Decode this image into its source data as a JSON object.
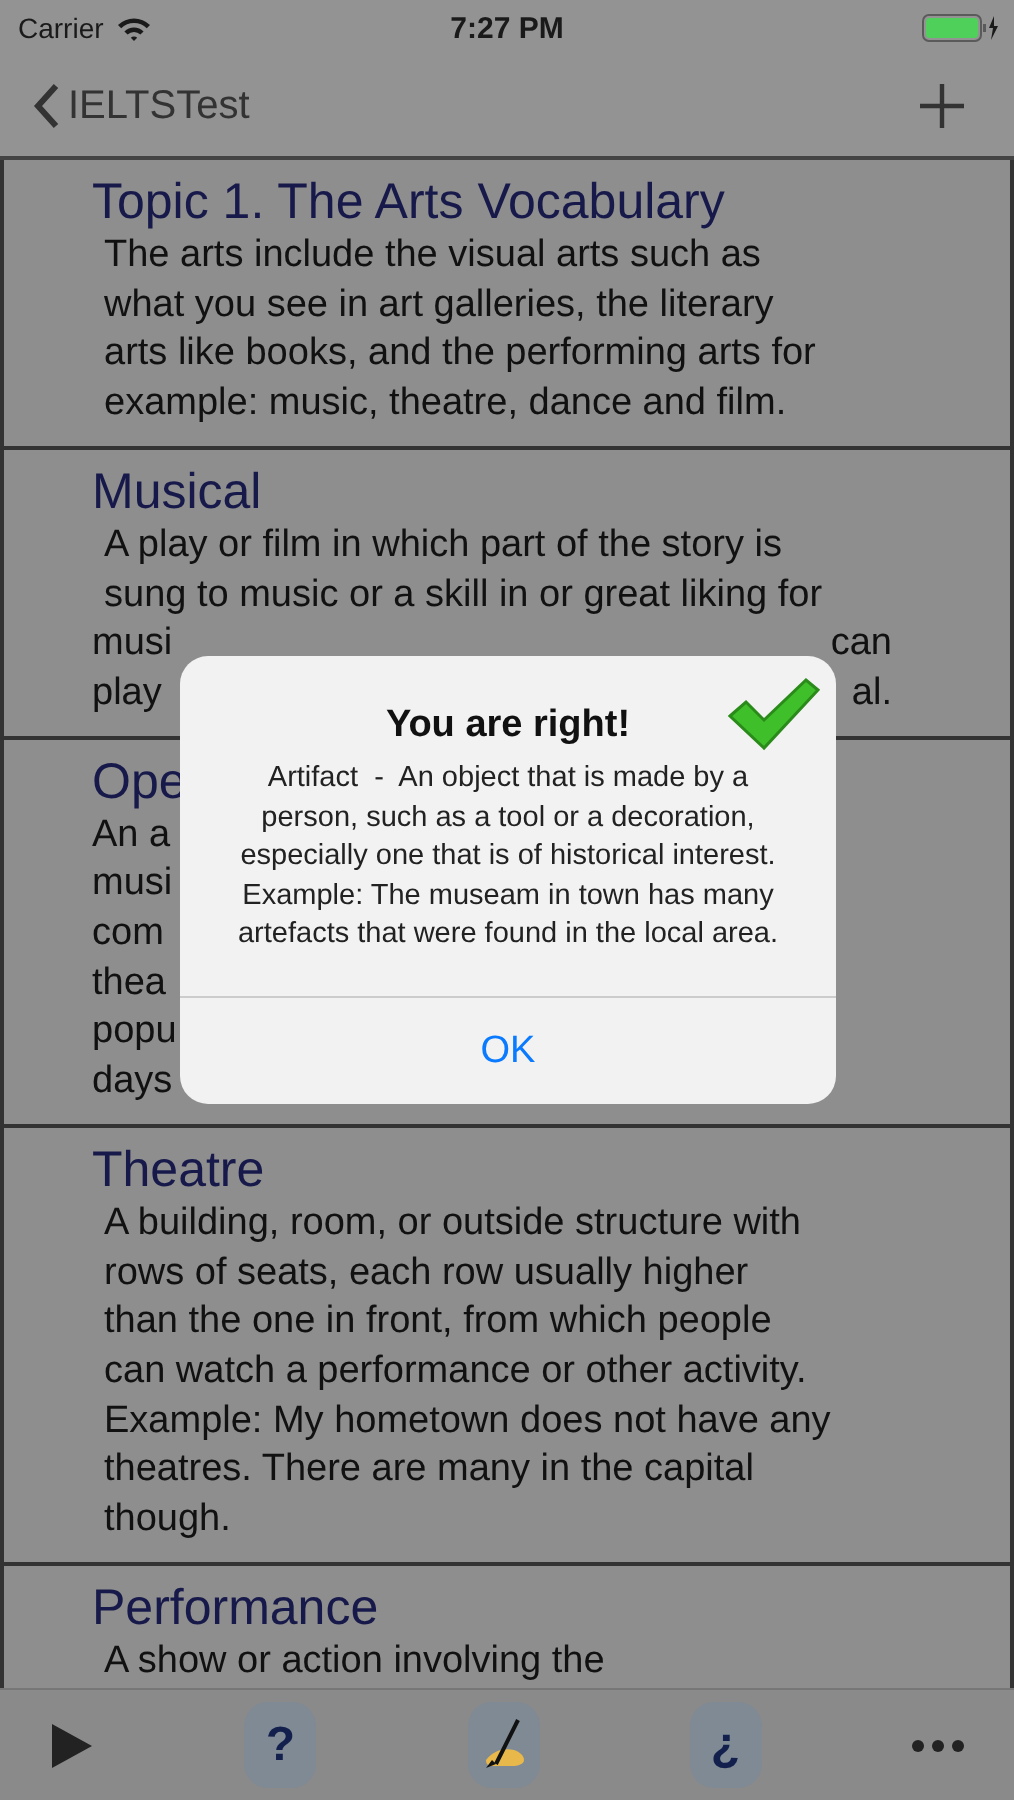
{
  "status_bar": {
    "carrier": "Carrier",
    "time": "7:27 PM"
  },
  "nav": {
    "back": "IELTSTest"
  },
  "cards": [
    {
      "title": "Topic 1. The Arts Vocabulary",
      "lines": [
        {
          "kind": "full",
          "text": "The arts include the visual arts such as"
        },
        {
          "kind": "full",
          "text": "what you see in art galleries, the literary"
        },
        {
          "kind": "full",
          "text": "arts like books, and the performing arts for"
        },
        {
          "kind": "full",
          "text": "example: music, theatre, dance and film."
        }
      ]
    },
    {
      "title": "Musical",
      "lines": [
        {
          "kind": "full",
          "text": "A play or film in which part of the story is"
        },
        {
          "kind": "full",
          "text": "sung to music or a skill in or great liking for"
        },
        {
          "kind": "split",
          "left": "musi",
          "right": "can"
        },
        {
          "kind": "split",
          "left": "play",
          "right": "al."
        }
      ]
    },
    {
      "title": "Ope",
      "lines": [
        {
          "kind": "split",
          "left": "An a"
        },
        {
          "kind": "split",
          "left": "musi"
        },
        {
          "kind": "split",
          "left": "com"
        },
        {
          "kind": "split",
          "left": "thea"
        },
        {
          "kind": "split",
          "left": "popu"
        },
        {
          "kind": "split",
          "left": "days"
        }
      ]
    },
    {
      "title": "Theatre",
      "lines": [
        {
          "kind": "full",
          "text": "A building, room, or outside structure with"
        },
        {
          "kind": "full",
          "text": "rows of seats, each row usually higher"
        },
        {
          "kind": "full",
          "text": "than the one in front, from which people"
        },
        {
          "kind": "full",
          "text": "can watch a performance or other activity."
        },
        {
          "kind": "full",
          "text": "Example: My hometown does not have any"
        },
        {
          "kind": "full",
          "text": "theatres. There are many in the capital"
        },
        {
          "kind": "full",
          "text": "though."
        }
      ]
    },
    {
      "title": "Performance",
      "lines": [
        {
          "kind": "full",
          "text": "A show or action involving the"
        }
      ]
    }
  ],
  "alert": {
    "title": "You are right!",
    "message": "Artifact  -  An object that is made by a person, such as a tool or a decoration, especially one that is of historical interest. Example: The museam in town has many artefacts that were found in the local area.",
    "button": "OK"
  },
  "toolbar": {
    "question": "?",
    "inverted_question": "¿"
  }
}
